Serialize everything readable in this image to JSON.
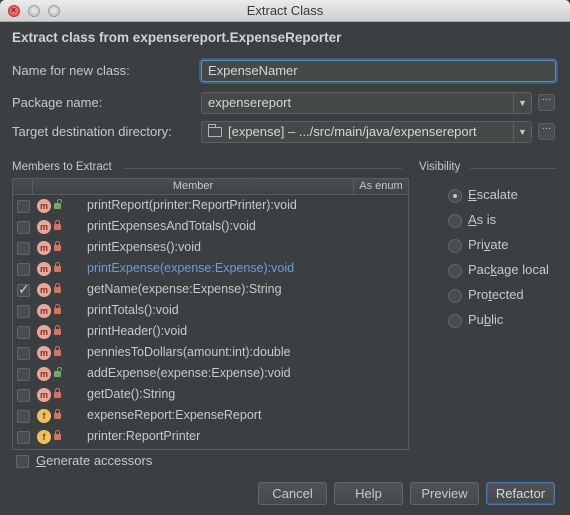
{
  "window": {
    "title": "Extract Class"
  },
  "dialog": {
    "heading": "Extract class from expensereport.ExpenseReporter"
  },
  "form": {
    "name_label": "Name for new class:",
    "name_value": "ExpenseNamer",
    "package_label": "Package name:",
    "package_value": "expensereport",
    "target_label": "Target destination directory:",
    "target_value": "[expense] – .../src/main/java/expensereport"
  },
  "members": {
    "section_label": "Members to Extract",
    "columns": {
      "member": "Member",
      "enum": "As enum"
    },
    "rows": [
      {
        "signature": "printReport(printer:ReportPrinter):void",
        "kind": "m",
        "visibility": "public",
        "checked": false,
        "highlight": false
      },
      {
        "signature": "printExpensesAndTotals():void",
        "kind": "m",
        "visibility": "private",
        "checked": false,
        "highlight": false
      },
      {
        "signature": "printExpenses():void",
        "kind": "m",
        "visibility": "private",
        "checked": false,
        "highlight": false
      },
      {
        "signature": "printExpense(expense:Expense):void",
        "kind": "m",
        "visibility": "private",
        "checked": false,
        "highlight": true
      },
      {
        "signature": "getName(expense:Expense):String",
        "kind": "m",
        "visibility": "private",
        "checked": true,
        "highlight": false
      },
      {
        "signature": "printTotals():void",
        "kind": "m",
        "visibility": "private",
        "checked": false,
        "highlight": false
      },
      {
        "signature": "printHeader():void",
        "kind": "m",
        "visibility": "private",
        "checked": false,
        "highlight": false
      },
      {
        "signature": "penniesToDollars(amount:int):double",
        "kind": "m",
        "visibility": "private",
        "checked": false,
        "highlight": false
      },
      {
        "signature": "addExpense(expense:Expense):void",
        "kind": "m",
        "visibility": "public",
        "checked": false,
        "highlight": false
      },
      {
        "signature": "getDate():String",
        "kind": "m",
        "visibility": "private",
        "checked": false,
        "highlight": false
      },
      {
        "signature": "expenseReport:ExpenseReport",
        "kind": "f",
        "visibility": "private",
        "checked": false,
        "highlight": false
      },
      {
        "signature": "printer:ReportPrinter",
        "kind": "f",
        "visibility": "private",
        "checked": false,
        "highlight": false
      }
    ]
  },
  "visibility": {
    "section_label": "Visibility",
    "options": [
      {
        "label": "Escalate",
        "selected": true
      },
      {
        "label": "As is",
        "selected": false
      },
      {
        "label": "Private",
        "selected": false
      },
      {
        "label": "Package local",
        "selected": false
      },
      {
        "label": "Protected",
        "selected": false
      },
      {
        "label": "Public",
        "selected": false
      }
    ]
  },
  "generate_accessors": {
    "label": "Generate accessors",
    "checked": false
  },
  "buttons": {
    "cancel": "Cancel",
    "help": "Help",
    "preview": "Preview",
    "refactor": "Refactor"
  },
  "icons": {
    "more": "ellipsis-icon",
    "dropdown": "chevron-down-icon",
    "folder": "folder-icon"
  }
}
